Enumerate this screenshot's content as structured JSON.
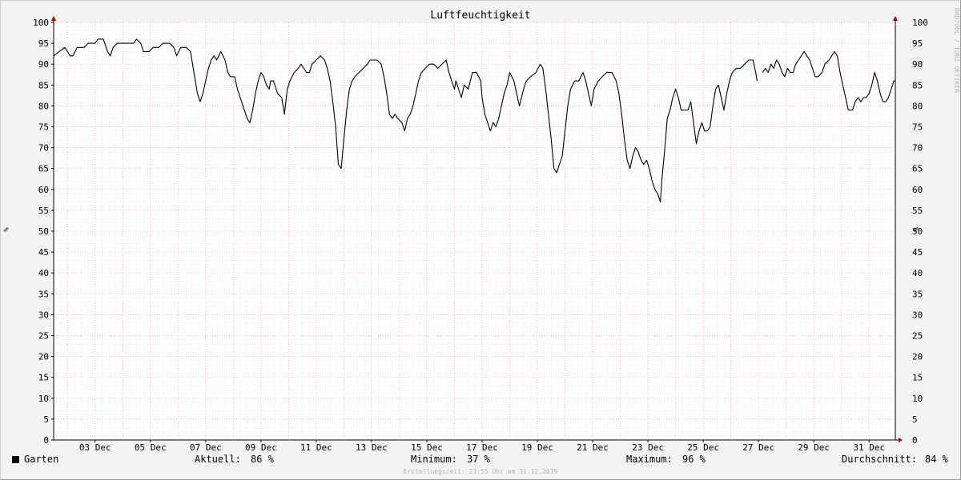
{
  "chart_data": {
    "type": "line",
    "title": "Luftfeuchtigkeit",
    "ylabel": "%",
    "ylim": [
      0,
      100
    ],
    "yticks": [
      0,
      5,
      10,
      15,
      20,
      25,
      30,
      35,
      40,
      45,
      50,
      55,
      60,
      65,
      70,
      75,
      80,
      85,
      90,
      95,
      100
    ],
    "xlim_days": [
      1.5,
      31.95
    ],
    "xticks": [
      {
        "label": "03 Dec",
        "day": 3
      },
      {
        "label": "05 Dec",
        "day": 5
      },
      {
        "label": "07 Dec",
        "day": 7
      },
      {
        "label": "09 Dec",
        "day": 9
      },
      {
        "label": "11 Dec",
        "day": 11
      },
      {
        "label": "13 Dec",
        "day": 13
      },
      {
        "label": "15 Dec",
        "day": 15
      },
      {
        "label": "17 Dec",
        "day": 17
      },
      {
        "label": "19 Dec",
        "day": 19
      },
      {
        "label": "21 Dec",
        "day": 21
      },
      {
        "label": "23 Dec",
        "day": 23
      },
      {
        "label": "25 Dec",
        "day": 25
      },
      {
        "label": "27 Dec",
        "day": 27
      },
      {
        "label": "29 Dec",
        "day": 29
      },
      {
        "label": "31 Dec",
        "day": 31
      }
    ],
    "grid": true,
    "series": [
      {
        "name": "Garten",
        "color": "#000000",
        "segments": [
          [
            [
              1.5,
              92
            ],
            [
              1.7,
              93
            ],
            [
              1.9,
              94
            ],
            [
              2.0,
              93
            ],
            [
              2.1,
              92
            ],
            [
              2.2,
              92
            ],
            [
              2.35,
              94
            ],
            [
              2.6,
              94
            ],
            [
              2.75,
              95
            ],
            [
              3.0,
              95
            ],
            [
              3.1,
              96
            ],
            [
              3.3,
              96
            ],
            [
              3.45,
              93
            ],
            [
              3.55,
              92
            ],
            [
              3.65,
              94
            ],
            [
              3.8,
              95
            ],
            [
              4.0,
              95
            ],
            [
              4.2,
              95
            ],
            [
              4.4,
              95
            ],
            [
              4.5,
              96
            ],
            [
              4.65,
              95
            ],
            [
              4.75,
              93
            ],
            [
              4.95,
              93
            ],
            [
              5.1,
              94
            ],
            [
              5.3,
              94
            ],
            [
              5.45,
              95
            ],
            [
              5.7,
              95
            ],
            [
              5.85,
              94
            ],
            [
              5.95,
              92
            ],
            [
              6.1,
              94
            ],
            [
              6.3,
              94
            ],
            [
              6.45,
              93
            ],
            [
              6.55,
              89
            ],
            [
              6.7,
              83
            ],
            [
              6.8,
              81
            ],
            [
              6.9,
              83
            ],
            [
              7.0,
              86
            ],
            [
              7.1,
              89
            ],
            [
              7.2,
              91
            ],
            [
              7.3,
              92
            ],
            [
              7.4,
              91
            ],
            [
              7.55,
              93
            ],
            [
              7.7,
              91
            ],
            [
              7.8,
              88
            ],
            [
              7.9,
              87
            ],
            [
              8.05,
              87
            ],
            [
              8.15,
              84
            ],
            [
              8.35,
              80
            ],
            [
              8.5,
              77
            ],
            [
              8.6,
              76
            ],
            [
              8.7,
              79
            ],
            [
              8.8,
              83
            ],
            [
              8.9,
              86
            ],
            [
              9.0,
              88
            ],
            [
              9.1,
              87
            ],
            [
              9.2,
              85
            ],
            [
              9.3,
              84
            ],
            [
              9.35,
              86
            ],
            [
              9.45,
              86
            ],
            [
              9.55,
              84
            ],
            [
              9.6,
              83
            ],
            [
              9.75,
              82
            ],
            [
              9.85,
              78
            ],
            [
              9.95,
              84
            ],
            [
              10.05,
              86
            ],
            [
              10.2,
              88
            ],
            [
              10.35,
              89
            ],
            [
              10.45,
              90
            ],
            [
              10.55,
              89
            ],
            [
              10.65,
              88
            ],
            [
              10.75,
              88
            ],
            [
              10.85,
              90
            ],
            [
              11.0,
              91
            ],
            [
              11.15,
              92
            ],
            [
              11.3,
              91
            ],
            [
              11.4,
              89
            ],
            [
              11.5,
              86
            ],
            [
              11.6,
              81
            ],
            [
              11.7,
              75
            ],
            [
              11.8,
              66
            ],
            [
              11.9,
              65
            ],
            [
              12.0,
              72
            ],
            [
              12.1,
              79
            ],
            [
              12.2,
              84
            ],
            [
              12.3,
              86
            ],
            [
              12.4,
              87
            ],
            [
              12.55,
              88
            ],
            [
              12.7,
              89
            ],
            [
              12.85,
              90
            ],
            [
              12.95,
              91
            ],
            [
              13.2,
              91
            ],
            [
              13.35,
              90
            ],
            [
              13.45,
              87
            ],
            [
              13.55,
              83
            ],
            [
              13.65,
              78
            ],
            [
              13.75,
              77
            ],
            [
              13.85,
              78
            ],
            [
              13.95,
              77
            ],
            [
              14.1,
              76
            ],
            [
              14.2,
              74
            ],
            [
              14.3,
              77
            ],
            [
              14.4,
              78
            ],
            [
              14.5,
              80
            ],
            [
              14.6,
              83
            ],
            [
              14.7,
              86
            ],
            [
              14.8,
              88
            ],
            [
              14.95,
              89
            ],
            [
              15.1,
              90
            ],
            [
              15.25,
              90
            ],
            [
              15.4,
              89
            ],
            [
              15.55,
              90
            ],
            [
              15.7,
              91
            ],
            [
              15.8,
              88
            ],
            [
              15.9,
              86
            ],
            [
              16.0,
              84
            ],
            [
              16.05,
              86
            ],
            [
              16.15,
              84
            ],
            [
              16.25,
              82
            ],
            [
              16.35,
              85
            ],
            [
              16.5,
              84
            ],
            [
              16.65,
              88
            ],
            [
              16.8,
              88
            ],
            [
              16.95,
              86
            ],
            [
              17.0,
              82
            ],
            [
              17.1,
              78
            ],
            [
              17.2,
              76
            ],
            [
              17.3,
              74
            ],
            [
              17.4,
              76
            ],
            [
              17.5,
              75
            ],
            [
              17.6,
              77
            ],
            [
              17.7,
              80
            ],
            [
              17.8,
              83
            ],
            [
              17.9,
              85
            ],
            [
              18.0,
              88
            ],
            [
              18.15,
              86
            ],
            [
              18.25,
              83
            ],
            [
              18.35,
              80
            ],
            [
              18.5,
              84
            ],
            [
              18.6,
              86
            ],
            [
              18.75,
              87
            ],
            [
              18.95,
              88
            ],
            [
              19.1,
              90
            ],
            [
              19.2,
              89
            ],
            [
              19.3,
              84
            ],
            [
              19.4,
              78
            ],
            [
              19.5,
              72
            ],
            [
              19.6,
              65
            ],
            [
              19.7,
              64
            ],
            [
              19.8,
              66
            ],
            [
              19.9,
              68
            ],
            [
              20.0,
              74
            ],
            [
              20.1,
              80
            ],
            [
              20.2,
              84
            ],
            [
              20.35,
              86
            ],
            [
              20.5,
              86
            ],
            [
              20.65,
              88
            ],
            [
              20.75,
              86
            ],
            [
              20.85,
              83
            ],
            [
              20.95,
              80
            ],
            [
              21.05,
              84
            ],
            [
              21.2,
              86
            ],
            [
              21.35,
              87
            ],
            [
              21.5,
              88
            ],
            [
              21.7,
              88
            ],
            [
              21.85,
              86
            ],
            [
              21.95,
              83
            ],
            [
              22.05,
              78
            ],
            [
              22.15,
              72
            ],
            [
              22.25,
              67
            ],
            [
              22.35,
              65
            ],
            [
              22.45,
              68
            ],
            [
              22.55,
              70
            ],
            [
              22.65,
              69
            ],
            [
              22.75,
              67
            ],
            [
              22.85,
              66
            ],
            [
              22.95,
              67
            ],
            [
              23.05,
              65
            ],
            [
              23.15,
              62
            ],
            [
              23.25,
              60
            ],
            [
              23.35,
              59
            ],
            [
              23.45,
              57
            ],
            [
              23.5,
              62
            ],
            [
              23.6,
              69
            ],
            [
              23.7,
              77
            ],
            [
              23.8,
              79
            ],
            [
              23.9,
              82
            ],
            [
              24.0,
              84
            ],
            [
              24.1,
              82
            ],
            [
              24.2,
              79
            ],
            [
              24.3,
              79
            ],
            [
              24.45,
              79
            ],
            [
              24.55,
              81
            ],
            [
              24.65,
              76
            ],
            [
              24.75,
              71
            ],
            [
              24.85,
              74
            ],
            [
              24.95,
              76
            ],
            [
              25.05,
              74
            ],
            [
              25.15,
              74
            ],
            [
              25.25,
              75
            ],
            [
              25.35,
              80
            ],
            [
              25.45,
              84
            ],
            [
              25.55,
              85
            ],
            [
              25.65,
              82
            ],
            [
              25.75,
              79
            ],
            [
              25.85,
              83
            ],
            [
              25.95,
              86
            ],
            [
              26.05,
              88
            ],
            [
              26.2,
              89
            ],
            [
              26.35,
              89
            ],
            [
              26.5,
              90
            ],
            [
              26.65,
              91
            ],
            [
              26.8,
              91
            ],
            [
              26.9,
              88
            ],
            [
              26.95,
              86
            ]
          ],
          [
            [
              27.15,
              88
            ],
            [
              27.25,
              89
            ],
            [
              27.35,
              88
            ],
            [
              27.45,
              90
            ],
            [
              27.55,
              89
            ],
            [
              27.65,
              91
            ],
            [
              27.75,
              90
            ],
            [
              27.85,
              88
            ],
            [
              27.95,
              87
            ],
            [
              28.05,
              89
            ],
            [
              28.15,
              88
            ],
            [
              28.25,
              88
            ],
            [
              28.35,
              90
            ],
            [
              28.45,
              91
            ],
            [
              28.55,
              92
            ],
            [
              28.65,
              93
            ],
            [
              28.75,
              92
            ],
            [
              28.85,
              91
            ],
            [
              28.95,
              89
            ],
            [
              29.05,
              87
            ],
            [
              29.15,
              87
            ],
            [
              29.3,
              88
            ],
            [
              29.4,
              90
            ],
            [
              29.55,
              91
            ],
            [
              29.65,
              92
            ],
            [
              29.75,
              93
            ],
            [
              29.85,
              92
            ],
            [
              29.95,
              88
            ],
            [
              30.05,
              85
            ],
            [
              30.15,
              82
            ],
            [
              30.25,
              79
            ],
            [
              30.4,
              79
            ],
            [
              30.5,
              81
            ],
            [
              30.6,
              82
            ],
            [
              30.7,
              81
            ],
            [
              30.8,
              82
            ],
            [
              30.9,
              82
            ],
            [
              31.0,
              83
            ],
            [
              31.1,
              85
            ],
            [
              31.2,
              88
            ],
            [
              31.3,
              86
            ],
            [
              31.4,
              83
            ],
            [
              31.5,
              81
            ],
            [
              31.6,
              81
            ],
            [
              31.7,
              82
            ],
            [
              31.8,
              84
            ],
            [
              31.9,
              86
            ],
            [
              31.95,
              86
            ]
          ]
        ]
      }
    ]
  },
  "legend": {
    "series_name": "Garten",
    "current_label": "Aktuell:",
    "current_value": "86 %",
    "minimum_label": "Minimum:",
    "minimum_value": "37 %",
    "maximum_label": "Maximum:",
    "maximum_value": "96 %",
    "average_label": "Durchschnitt:",
    "average_value": "84 %"
  },
  "footer": "Erstellungszeit: 23:55 Uhr am 31.12.2019",
  "watermark": "RRDTOOL / TOBI OETIKER"
}
